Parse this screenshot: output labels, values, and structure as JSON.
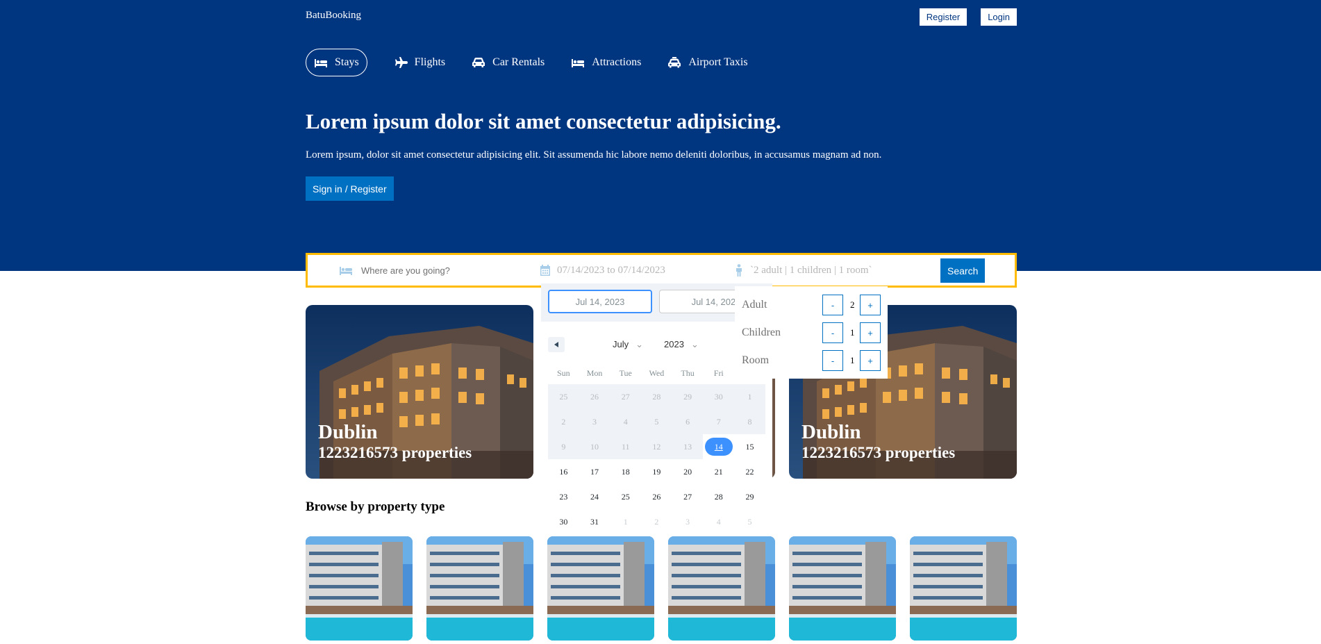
{
  "header": {
    "logo": "BatuBooking",
    "register_label": "Register",
    "login_label": "Login"
  },
  "nav": {
    "items": [
      {
        "label": "Stays",
        "icon": "bed-icon",
        "active": true
      },
      {
        "label": "Flights",
        "icon": "plane-icon",
        "active": false
      },
      {
        "label": "Car Rentals",
        "icon": "car-icon",
        "active": false
      },
      {
        "label": "Attractions",
        "icon": "bed-icon",
        "active": false
      },
      {
        "label": "Airport Taxis",
        "icon": "taxi-icon",
        "active": false
      }
    ]
  },
  "hero": {
    "title": "Lorem ipsum dolor sit amet consectetur adipisicing.",
    "description": "Lorem ipsum, dolor sit amet consectetur adipisicing elit. Sit assumenda hic labore nemo deleniti doloribus, in accusamus magnam ad non.",
    "cta_label": "Sign in / Register"
  },
  "search": {
    "destination_placeholder": "Where are you going?",
    "date_text": "07/14/2023 to 07/14/2023",
    "options_text": "`2 adult | 1 children | 1 room`",
    "search_label": "Search"
  },
  "datepicker": {
    "start_input": "Jul 14, 2023",
    "end_input": "Jul 14, 2023",
    "month": "July",
    "year": "2023",
    "weekdays": [
      "Sun",
      "Mon",
      "Tue",
      "Wed",
      "Thu",
      "Fri",
      "Sat"
    ],
    "days": [
      {
        "d": "25",
        "s": "past"
      },
      {
        "d": "26",
        "s": "past"
      },
      {
        "d": "27",
        "s": "past"
      },
      {
        "d": "28",
        "s": "past"
      },
      {
        "d": "29",
        "s": "past"
      },
      {
        "d": "30",
        "s": "past"
      },
      {
        "d": "1",
        "s": "past"
      },
      {
        "d": "2",
        "s": "past"
      },
      {
        "d": "3",
        "s": "past"
      },
      {
        "d": "4",
        "s": "past"
      },
      {
        "d": "5",
        "s": "past"
      },
      {
        "d": "6",
        "s": "past"
      },
      {
        "d": "7",
        "s": "past"
      },
      {
        "d": "8",
        "s": "past"
      },
      {
        "d": "9",
        "s": "past"
      },
      {
        "d": "10",
        "s": "past"
      },
      {
        "d": "11",
        "s": "past"
      },
      {
        "d": "12",
        "s": "past"
      },
      {
        "d": "13",
        "s": "past"
      },
      {
        "d": "14",
        "s": "selected"
      },
      {
        "d": "15",
        "s": "normal"
      },
      {
        "d": "16",
        "s": "normal"
      },
      {
        "d": "17",
        "s": "normal"
      },
      {
        "d": "18",
        "s": "normal"
      },
      {
        "d": "19",
        "s": "normal"
      },
      {
        "d": "20",
        "s": "normal"
      },
      {
        "d": "21",
        "s": "normal"
      },
      {
        "d": "22",
        "s": "normal"
      },
      {
        "d": "23",
        "s": "normal"
      },
      {
        "d": "24",
        "s": "normal"
      },
      {
        "d": "25",
        "s": "normal"
      },
      {
        "d": "26",
        "s": "normal"
      },
      {
        "d": "27",
        "s": "normal"
      },
      {
        "d": "28",
        "s": "normal"
      },
      {
        "d": "29",
        "s": "normal"
      },
      {
        "d": "30",
        "s": "normal"
      },
      {
        "d": "31",
        "s": "normal"
      },
      {
        "d": "1",
        "s": "other"
      },
      {
        "d": "2",
        "s": "other"
      },
      {
        "d": "3",
        "s": "other"
      },
      {
        "d": "4",
        "s": "other"
      },
      {
        "d": "5",
        "s": "other"
      }
    ]
  },
  "options": {
    "adult_label": "Adult",
    "adult_value": "2",
    "children_label": "Children",
    "children_value": "1",
    "room_label": "Room",
    "room_value": "1",
    "minus": "-",
    "plus": "+"
  },
  "featured": {
    "cards": [
      {
        "city": "Dublin",
        "properties": "1223216573 properties"
      },
      {
        "city": "Dublin",
        "properties": "1223216573 properties"
      }
    ]
  },
  "property_types": {
    "title": "Browse by property type"
  },
  "colors": {
    "brand_blue": "#003580",
    "button_blue": "#0071c2",
    "search_border": "#febb02",
    "calendar_accent": "#3d91ff"
  }
}
